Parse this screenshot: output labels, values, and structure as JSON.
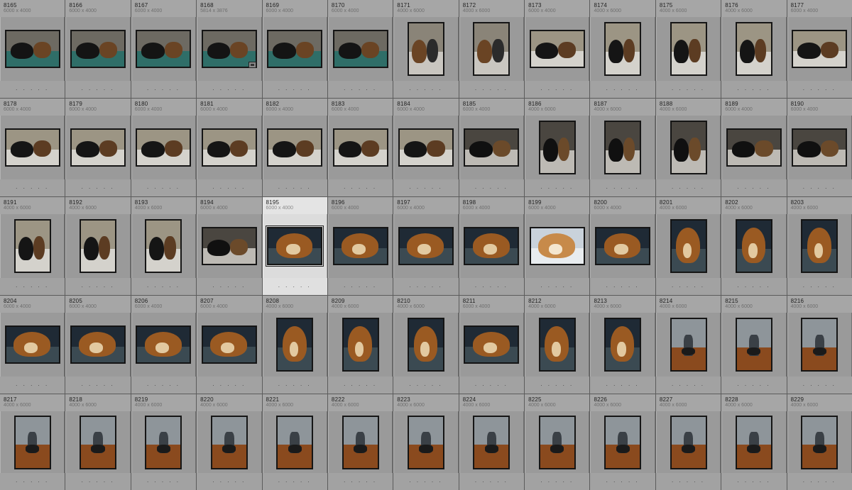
{
  "app": {
    "view": "Library Grid"
  },
  "selected_index": 30,
  "colors": {
    "cell_bg": "#9a9a9a",
    "cell_header": "#a6a6a6",
    "selected_bg": "#dcdcdc",
    "separator": "#5c5c5c"
  },
  "dots_label": ". . . . .",
  "thumbnails": [
    {
      "number": "8165",
      "dims": "6000 x 4000",
      "orient": "land",
      "scene": "couch-dogs"
    },
    {
      "number": "8166",
      "dims": "6000 x 4000",
      "orient": "land",
      "scene": "couch-dogs"
    },
    {
      "number": "8167",
      "dims": "6000 x 4000",
      "orient": "land",
      "scene": "couch-dogs"
    },
    {
      "number": "8168",
      "dims": "5814 x 3876",
      "orient": "land",
      "scene": "couch-dogs",
      "badge": "crop-icon"
    },
    {
      "number": "8169",
      "dims": "6000 x 4000",
      "orient": "land",
      "scene": "couch-dogs"
    },
    {
      "number": "8170",
      "dims": "6000 x 4000",
      "orient": "land",
      "scene": "couch-dogs"
    },
    {
      "number": "8171",
      "dims": "4000 x 6000",
      "orient": "port",
      "scene": "floor-dog"
    },
    {
      "number": "8172",
      "dims": "4000 x 6000",
      "orient": "port",
      "scene": "floor-dog"
    },
    {
      "number": "8173",
      "dims": "6000 x 4000",
      "orient": "land",
      "scene": "floor-dogs"
    },
    {
      "number": "8174",
      "dims": "4000 x 6000",
      "orient": "port",
      "scene": "floor-dogs"
    },
    {
      "number": "8175",
      "dims": "4000 x 6000",
      "orient": "port",
      "scene": "floor-dogs"
    },
    {
      "number": "8176",
      "dims": "4000 x 6000",
      "orient": "port",
      "scene": "floor-dogs"
    },
    {
      "number": "8177",
      "dims": "6000 x 4000",
      "orient": "land",
      "scene": "floor-dogs"
    },
    {
      "number": "8178",
      "dims": "6000 x 4000",
      "orient": "land",
      "scene": "floor-dogs"
    },
    {
      "number": "8179",
      "dims": "6000 x 4000",
      "orient": "land",
      "scene": "floor-dogs"
    },
    {
      "number": "8180",
      "dims": "6000 x 4000",
      "orient": "land",
      "scene": "floor-dogs"
    },
    {
      "number": "8181",
      "dims": "6000 x 4000",
      "orient": "land",
      "scene": "floor-dogs"
    },
    {
      "number": "8182",
      "dims": "6000 x 4000",
      "orient": "land",
      "scene": "floor-dogs"
    },
    {
      "number": "8183",
      "dims": "6000 x 4000",
      "orient": "land",
      "scene": "floor-dogs"
    },
    {
      "number": "8184",
      "dims": "6000 x 4000",
      "orient": "land",
      "scene": "floor-dogs"
    },
    {
      "number": "8185",
      "dims": "6000 x 4000",
      "orient": "land",
      "scene": "dark-dogs"
    },
    {
      "number": "8186",
      "dims": "4000 x 6000",
      "orient": "port",
      "scene": "dark-dogs"
    },
    {
      "number": "8187",
      "dims": "4000 x 6000",
      "orient": "port",
      "scene": "dark-dogs"
    },
    {
      "number": "8188",
      "dims": "4000 x 6000",
      "orient": "port",
      "scene": "dark-dogs"
    },
    {
      "number": "8189",
      "dims": "6000 x 4000",
      "orient": "land",
      "scene": "dark-dogs"
    },
    {
      "number": "8190",
      "dims": "6000 x 4000",
      "orient": "land",
      "scene": "dark-dogs"
    },
    {
      "number": "8191",
      "dims": "4000 x 6000",
      "orient": "port",
      "scene": "floor-dogs"
    },
    {
      "number": "8192",
      "dims": "4000 x 6000",
      "orient": "port",
      "scene": "floor-dogs"
    },
    {
      "number": "8193",
      "dims": "4000 x 6000",
      "orient": "port",
      "scene": "floor-dogs"
    },
    {
      "number": "8194",
      "dims": "6000 x 4000",
      "orient": "land",
      "scene": "dark-dogs"
    },
    {
      "number": "8195",
      "dims": "6000 x 4000",
      "orient": "land",
      "scene": "beagle"
    },
    {
      "number": "8196",
      "dims": "6000 x 4000",
      "orient": "land",
      "scene": "beagle"
    },
    {
      "number": "8197",
      "dims": "6000 x 4000",
      "orient": "land",
      "scene": "beagle"
    },
    {
      "number": "8198",
      "dims": "6000 x 4000",
      "orient": "land",
      "scene": "beagle"
    },
    {
      "number": "8199",
      "dims": "6000 x 4000",
      "orient": "land",
      "scene": "beagle-bright"
    },
    {
      "number": "8200",
      "dims": "6000 x 4000",
      "orient": "land",
      "scene": "beagle"
    },
    {
      "number": "8201",
      "dims": "4000 x 6000",
      "orient": "port",
      "scene": "beagle"
    },
    {
      "number": "8202",
      "dims": "4000 x 6000",
      "orient": "port",
      "scene": "beagle"
    },
    {
      "number": "8203",
      "dims": "4000 x 6000",
      "orient": "port",
      "scene": "beagle"
    },
    {
      "number": "8204",
      "dims": "6000 x 4000",
      "orient": "land",
      "scene": "beagle"
    },
    {
      "number": "8205",
      "dims": "6000 x 4000",
      "orient": "land",
      "scene": "beagle"
    },
    {
      "number": "8206",
      "dims": "6000 x 4000",
      "orient": "land",
      "scene": "beagle"
    },
    {
      "number": "8207",
      "dims": "6000 x 4000",
      "orient": "land",
      "scene": "beagle"
    },
    {
      "number": "8208",
      "dims": "4000 x 6000",
      "orient": "port",
      "scene": "beagle"
    },
    {
      "number": "8209",
      "dims": "4000 x 6000",
      "orient": "port",
      "scene": "beagle"
    },
    {
      "number": "8210",
      "dims": "4000 x 6000",
      "orient": "port",
      "scene": "beagle"
    },
    {
      "number": "8211",
      "dims": "6000 x 4000",
      "orient": "land",
      "scene": "beagle"
    },
    {
      "number": "8212",
      "dims": "4000 x 6000",
      "orient": "port",
      "scene": "beagle"
    },
    {
      "number": "8213",
      "dims": "4000 x 6000",
      "orient": "port",
      "scene": "beagle"
    },
    {
      "number": "8214",
      "dims": "4000 x 6000",
      "orient": "port",
      "scene": "person"
    },
    {
      "number": "8215",
      "dims": "4000 x 6000",
      "orient": "port",
      "scene": "person"
    },
    {
      "number": "8216",
      "dims": "4000 x 6000",
      "orient": "port",
      "scene": "person"
    },
    {
      "number": "8217",
      "dims": "4000 x 6000",
      "orient": "port",
      "scene": "person"
    },
    {
      "number": "8218",
      "dims": "4000 x 6000",
      "orient": "port",
      "scene": "person"
    },
    {
      "number": "8219",
      "dims": "4000 x 6000",
      "orient": "port",
      "scene": "person"
    },
    {
      "number": "8220",
      "dims": "4000 x 6000",
      "orient": "port",
      "scene": "person"
    },
    {
      "number": "8221",
      "dims": "4000 x 6000",
      "orient": "port",
      "scene": "person"
    },
    {
      "number": "8222",
      "dims": "4000 x 6000",
      "orient": "port",
      "scene": "person"
    },
    {
      "number": "8223",
      "dims": "4000 x 6000",
      "orient": "port",
      "scene": "person"
    },
    {
      "number": "8224",
      "dims": "4000 x 6000",
      "orient": "port",
      "scene": "person"
    },
    {
      "number": "8225",
      "dims": "4000 x 6000",
      "orient": "port",
      "scene": "person"
    },
    {
      "number": "8226",
      "dims": "4000 x 6000",
      "orient": "port",
      "scene": "person"
    },
    {
      "number": "8227",
      "dims": "4000 x 6000",
      "orient": "port",
      "scene": "person"
    },
    {
      "number": "8228",
      "dims": "4000 x 6000",
      "orient": "port",
      "scene": "person"
    },
    {
      "number": "8229",
      "dims": "4000 x 6000",
      "orient": "port",
      "scene": "person"
    }
  ]
}
